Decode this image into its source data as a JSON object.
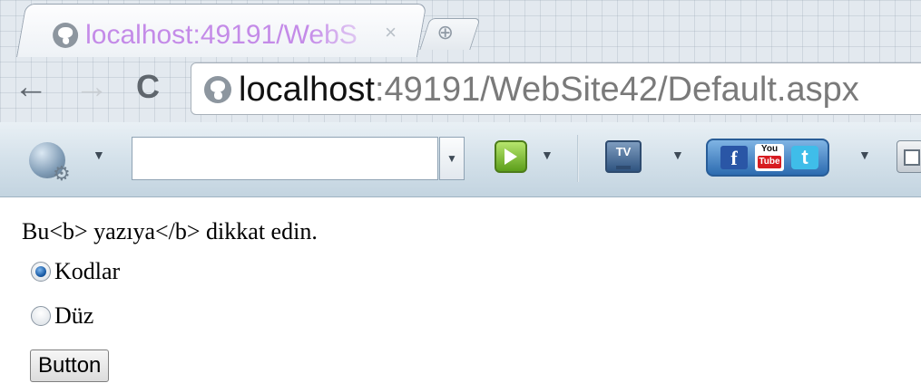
{
  "browser": {
    "tab": {
      "title": "localhost:49191/WebS",
      "close_glyph": "×",
      "favicon": "globe-icon"
    },
    "new_tab_glyph": "⊕",
    "nav": {
      "back_glyph": "←",
      "forward_glyph": "→",
      "reload_glyph": "C"
    },
    "address_bar": {
      "host": "localhost",
      "path": ":49191/WebSite42/Default.aspx"
    },
    "extension_toolbar": {
      "search_value": "",
      "dropdown_glyph": "▼",
      "tv_label": "TV",
      "facebook_label": "f",
      "youtube_top": "You",
      "youtube_bottom": "Tube",
      "twitter_label": "t"
    }
  },
  "page": {
    "message": "Bu<b> yazıya</b> dikkat edin.",
    "radio_options": [
      {
        "label": "Kodlar",
        "checked": true
      },
      {
        "label": "Düz",
        "checked": false
      }
    ],
    "button_label": "Button"
  }
}
